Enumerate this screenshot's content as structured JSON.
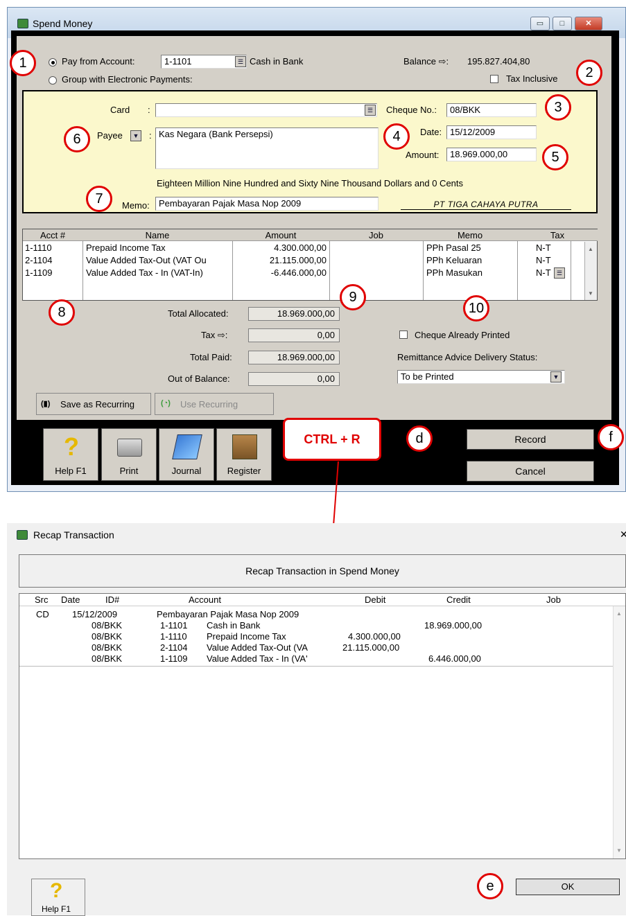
{
  "window1": {
    "title": "Spend Money",
    "controls": {
      "minimize": "▭",
      "maximize": "□",
      "close": "✕"
    }
  },
  "top": {
    "pay_from_label": "Pay from Account:",
    "pay_from_account": "1-1101",
    "pay_from_account_name": "Cash in Bank",
    "group_label": "Group with Electronic Payments:",
    "balance_label": "Balance ⇨:",
    "balance_value": "195.827.404,80",
    "tax_inclusive_label": "Tax Inclusive"
  },
  "card_panel": {
    "card_label": "Card",
    "colon": ":",
    "card_value": "",
    "payee_label": "Payee",
    "payee_value": "Kas Negara (Bank Persepsi)",
    "cheque_label": "Cheque No.:",
    "cheque_value": "08/BKK",
    "date_label": "Date:",
    "date_value": "15/12/2009",
    "amount_label": "Amount:",
    "amount_value": "18.969.000,00",
    "amount_words": "Eighteen Million Nine Hundred and Sixty Nine Thousand Dollars and 0 Cents",
    "memo_label": "Memo:",
    "memo_value": "Pembayaran Pajak Masa Nop 2009",
    "company": "PT TIGA CAHAYA PUTRA"
  },
  "grid": {
    "headers": [
      "Acct #",
      "Name",
      "Amount",
      "Job",
      "Memo",
      "Tax"
    ],
    "rows": [
      {
        "acct": "1-1110",
        "name": "Prepaid Income Tax",
        "amount": "4.300.000,00",
        "job": "",
        "memo": "PPh Pasal 25",
        "tax": "N-T"
      },
      {
        "acct": "2-1104",
        "name": "Value Added Tax-Out (VAT Ou",
        "amount": "21.115.000,00",
        "job": "",
        "memo": "PPh Keluaran",
        "tax": "N-T"
      },
      {
        "acct": "1-1109",
        "name": "Value Added Tax - In (VAT-In)",
        "amount": "-6.446.000,00",
        "job": "",
        "memo": "PPh Masukan",
        "tax": "N-T"
      }
    ]
  },
  "totals": {
    "allocated_label": "Total Allocated:",
    "allocated_value": "18.969.000,00",
    "tax_label": "Tax ⇨:",
    "tax_value": "0,00",
    "paid_label": "Total Paid:",
    "paid_value": "18.969.000,00",
    "oob_label": "Out of Balance:",
    "oob_value": "0,00",
    "cheque_printed_label": "Cheque Already Printed",
    "remittance_label": "Remittance Advice Delivery Status:",
    "remittance_value": "To be Printed"
  },
  "buttons": {
    "save_recurring": "Save as Recurring",
    "use_recurring": "Use Recurring",
    "help": "Help F1",
    "print": "Print",
    "journal": "Journal",
    "register": "Register",
    "record": "Record",
    "cancel": "Cancel"
  },
  "annotations": {
    "c1": "1",
    "c2": "2",
    "c3": "3",
    "c4": "4",
    "c5": "5",
    "c6": "6",
    "c7": "7",
    "c8": "8",
    "c9": "9",
    "c10": "10",
    "d": "d",
    "e": "e",
    "f": "f",
    "shortcut": "CTRL + R"
  },
  "window2": {
    "title": "Recap Transaction",
    "close": "✕",
    "heading": "Recap Transaction in Spend Money",
    "headers": [
      "Src",
      "Date",
      "ID#",
      "Account",
      "Debit",
      "Credit",
      "Job"
    ],
    "header_row": {
      "src": "CD",
      "date": "15/12/2009",
      "desc": "Pembayaran Pajak Masa Nop 2009"
    },
    "rows": [
      {
        "id": "08/BKK",
        "acct": "1-1101",
        "name": "Cash in Bank",
        "debit": "",
        "credit": "18.969.000,00"
      },
      {
        "id": "08/BKK",
        "acct": "1-1110",
        "name": "Prepaid Income Tax",
        "debit": "4.300.000,00",
        "credit": ""
      },
      {
        "id": "08/BKK",
        "acct": "2-1104",
        "name": "Value Added Tax-Out (VA",
        "debit": "21.115.000,00",
        "credit": ""
      },
      {
        "id": "08/BKK",
        "acct": "1-1109",
        "name": "Value Added Tax - In (VA'",
        "debit": "",
        "credit": "6.446.000,00"
      }
    ],
    "help": "Help F1",
    "ok": "OK"
  }
}
